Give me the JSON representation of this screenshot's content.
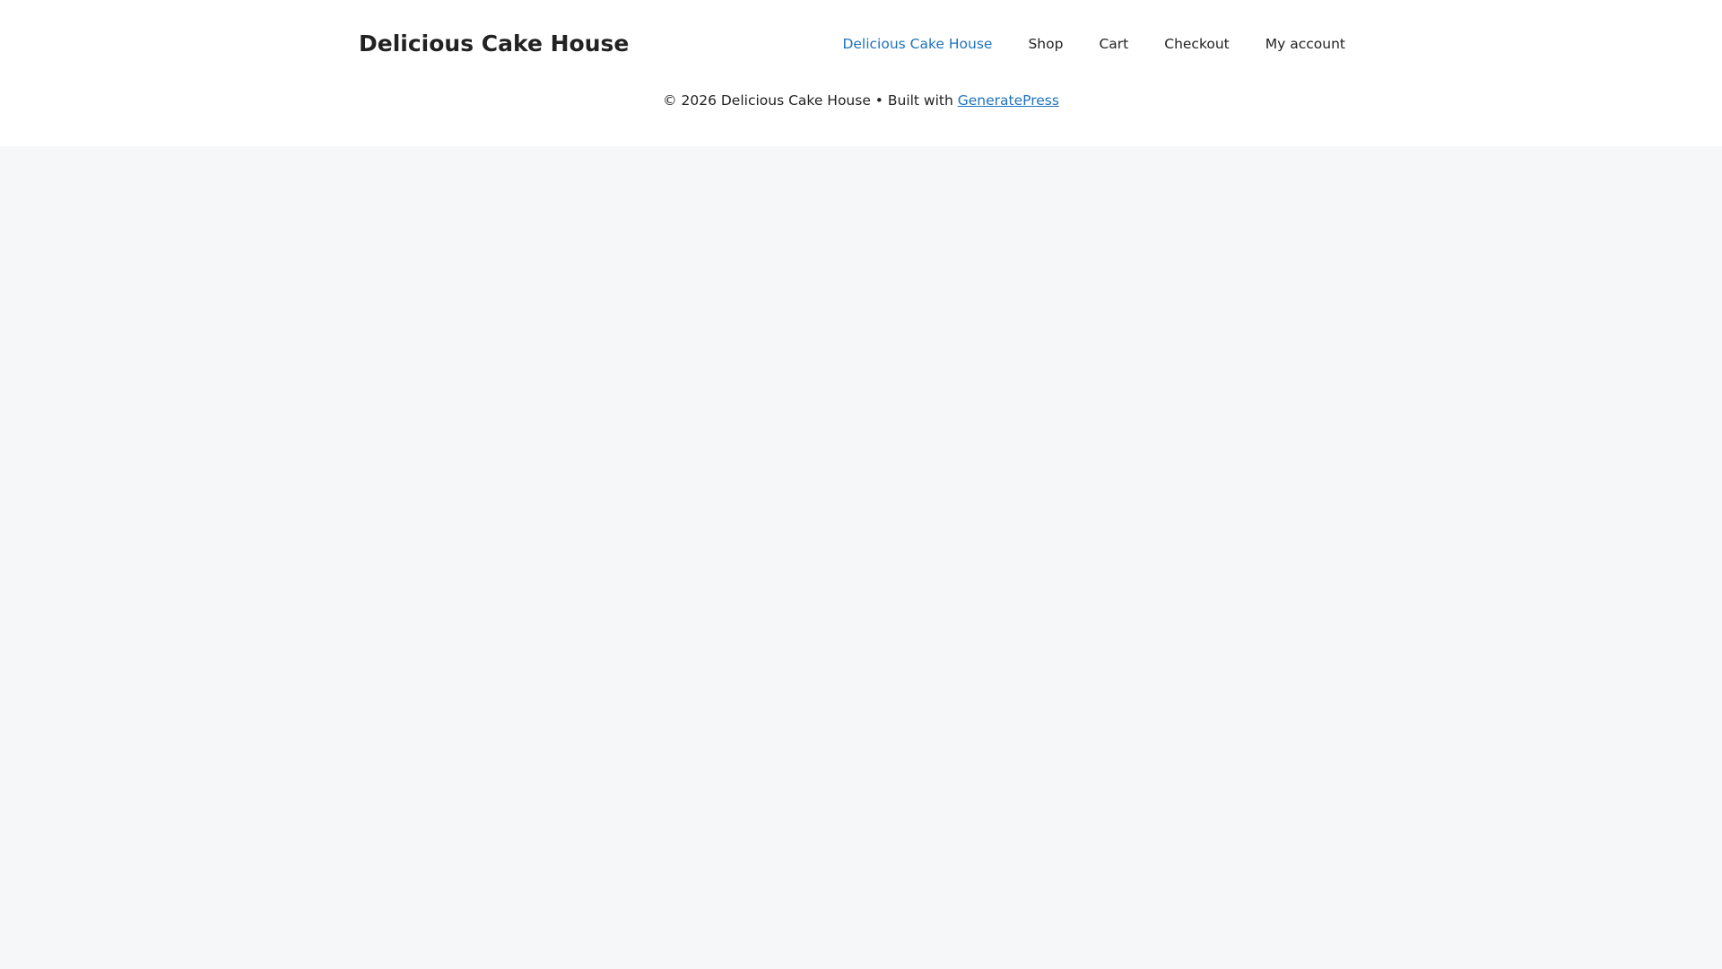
{
  "header": {
    "site_title": "Delicious Cake House",
    "nav": {
      "home": "Delicious Cake House",
      "shop": "Shop",
      "cart": "Cart",
      "checkout": "Checkout",
      "account": "My account"
    }
  },
  "footer": {
    "copyright_text": "© 2026 Delicious Cake House • Built with ",
    "theme_link": "GeneratePress"
  },
  "colors": {
    "link": "#1e73be",
    "text": "#222222",
    "background": "#f6f7f9",
    "header_bg": "#ffffff"
  }
}
